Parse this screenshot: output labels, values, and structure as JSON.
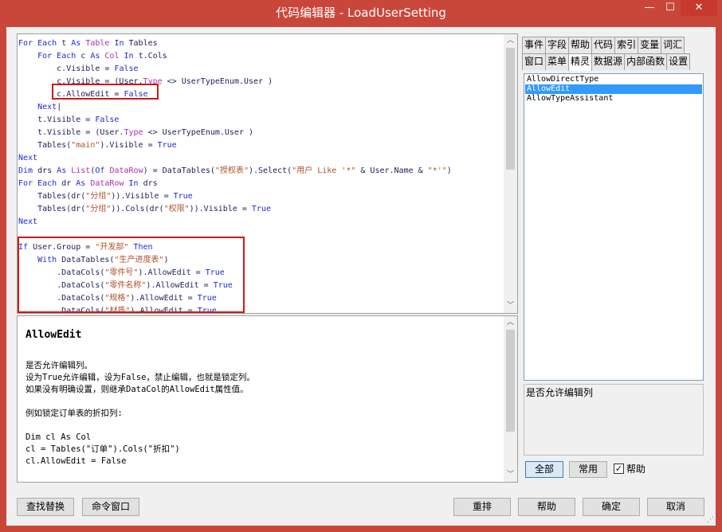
{
  "window": {
    "title": "代码编辑器 - LoadUserSetting",
    "minimize": "—",
    "maximize": "☐",
    "close": "✕"
  },
  "code_lines": [
    [
      {
        "t": "For Each",
        "c": "kw"
      },
      {
        "t": " t "
      },
      {
        "t": "As",
        "c": "kw"
      },
      {
        "t": " "
      },
      {
        "t": "Table",
        "c": "ty"
      },
      {
        "t": " "
      },
      {
        "t": "In",
        "c": "kw"
      },
      {
        "t": " Tables"
      }
    ],
    [
      {
        "t": "    "
      },
      {
        "t": "For Each",
        "c": "kw"
      },
      {
        "t": " c "
      },
      {
        "t": "As",
        "c": "kw"
      },
      {
        "t": " "
      },
      {
        "t": "Col",
        "c": "ty"
      },
      {
        "t": " "
      },
      {
        "t": "In",
        "c": "kw"
      },
      {
        "t": " t.Cols"
      }
    ],
    [
      {
        "t": "        c.Visible = "
      },
      {
        "t": "False",
        "c": "kw"
      }
    ],
    [
      {
        "t": "        c.Visible = (User."
      },
      {
        "t": "Type",
        "c": "ty"
      },
      {
        "t": " <> UserTypeEnum.User )"
      }
    ],
    [
      {
        "t": "        c.AllowEdit = "
      },
      {
        "t": "False",
        "c": "kw"
      }
    ],
    [
      {
        "t": "    "
      },
      {
        "t": "Next",
        "c": "kw"
      },
      {
        "t": "|"
      }
    ],
    [
      {
        "t": "    t.Visible = "
      },
      {
        "t": "False",
        "c": "kw"
      }
    ],
    [
      {
        "t": "    t.Visible = (User."
      },
      {
        "t": "Type",
        "c": "ty"
      },
      {
        "t": " <> UserTypeEnum.User )"
      }
    ],
    [
      {
        "t": "    Tables("
      },
      {
        "t": "\"main\"",
        "c": "st"
      },
      {
        "t": ").Visible = "
      },
      {
        "t": "True",
        "c": "kw"
      }
    ],
    [
      {
        "t": "Next",
        "c": "kw"
      }
    ],
    [
      {
        "t": "Dim",
        "c": "kw"
      },
      {
        "t": " drs "
      },
      {
        "t": "As",
        "c": "kw"
      },
      {
        "t": " "
      },
      {
        "t": "List",
        "c": "ty"
      },
      {
        "t": "("
      },
      {
        "t": "Of",
        "c": "kw"
      },
      {
        "t": " "
      },
      {
        "t": "DataRow",
        "c": "ty"
      },
      {
        "t": ") = DataTables("
      },
      {
        "t": "\"授权表\"",
        "c": "st"
      },
      {
        "t": ").Select("
      },
      {
        "t": "\"用户 Like '*\"",
        "c": "st"
      },
      {
        "t": " & User.Name & "
      },
      {
        "t": "\"*'\"",
        "c": "st"
      },
      {
        "t": ")"
      }
    ],
    [
      {
        "t": "For Each",
        "c": "kw"
      },
      {
        "t": " dr "
      },
      {
        "t": "As",
        "c": "kw"
      },
      {
        "t": " "
      },
      {
        "t": "DataRow",
        "c": "ty"
      },
      {
        "t": " "
      },
      {
        "t": "In",
        "c": "kw"
      },
      {
        "t": " drs"
      }
    ],
    [
      {
        "t": "    Tables(dr("
      },
      {
        "t": "\"分组\"",
        "c": "st"
      },
      {
        "t": ")).Visible = "
      },
      {
        "t": "True",
        "c": "kw"
      }
    ],
    [
      {
        "t": "    Tables(dr("
      },
      {
        "t": "\"分组\"",
        "c": "st"
      },
      {
        "t": ")).Cols(dr("
      },
      {
        "t": "\"权限\"",
        "c": "st"
      },
      {
        "t": ")).Visible = "
      },
      {
        "t": "True",
        "c": "kw"
      }
    ],
    [
      {
        "t": "Next",
        "c": "kw"
      }
    ],
    [
      {
        "t": ""
      }
    ],
    [
      {
        "t": "If",
        "c": "kw"
      },
      {
        "t": " User.Group = "
      },
      {
        "t": "\"开发部\"",
        "c": "st"
      },
      {
        "t": " "
      },
      {
        "t": "Then",
        "c": "kw"
      }
    ],
    [
      {
        "t": "    "
      },
      {
        "t": "With",
        "c": "kw"
      },
      {
        "t": " DataTables("
      },
      {
        "t": "\"生产进度表\"",
        "c": "st"
      },
      {
        "t": ")"
      }
    ],
    [
      {
        "t": "        .DataCols("
      },
      {
        "t": "\"零件号\"",
        "c": "st"
      },
      {
        "t": ").AllowEdit = "
      },
      {
        "t": "True",
        "c": "kw"
      }
    ],
    [
      {
        "t": "        .DataCols("
      },
      {
        "t": "\"零件名称\"",
        "c": "st"
      },
      {
        "t": ").AllowEdit = "
      },
      {
        "t": "True",
        "c": "kw"
      }
    ],
    [
      {
        "t": "        .DataCols("
      },
      {
        "t": "\"规格\"",
        "c": "st"
      },
      {
        "t": ").AllowEdit = "
      },
      {
        "t": "True",
        "c": "kw"
      }
    ],
    [
      {
        "t": "        .DataCols("
      },
      {
        "t": "\"材质\"",
        "c": "st"
      },
      {
        "t": ").AllowEdit = "
      },
      {
        "t": "True",
        "c": "kw"
      }
    ]
  ],
  "help": {
    "title": "AllowEdit",
    "body": "是否允许编辑列。\n设为True允许编辑，设为False，禁止编辑，也就是锁定列。\n如果没有明确设置，则继承DataCol的AllowEdit属性值。\n\n例如锁定订单表的折扣列:\n\nDim cl As Col\ncl = Tables(\"订单\").Cols(\"折扣\")\ncl.AllowEdit = False"
  },
  "tabs_row1": [
    "事件",
    "字段",
    "帮助",
    "代码",
    "索引",
    "变量",
    "词汇"
  ],
  "tabs_row2": [
    "窗口",
    "菜单",
    "精灵",
    "数据源",
    "内部函数",
    "设置"
  ],
  "active_tab": "精灵",
  "list_items": [
    "AllowDirectType",
    "AllowEdit",
    "AllowTypeAssistant"
  ],
  "selected_item": "AllowEdit",
  "description": "是否允许编辑列",
  "panel_buttons": {
    "all": "全部",
    "common": "常用",
    "help_check": "帮助"
  },
  "bottom_buttons": {
    "find_replace": "查找替换",
    "command_window": "命令窗口",
    "rearrange": "重排",
    "help": "帮助",
    "ok": "确定",
    "cancel": "取消"
  },
  "scroll_glyphs": {
    "up": "︿",
    "down": "﹀"
  }
}
